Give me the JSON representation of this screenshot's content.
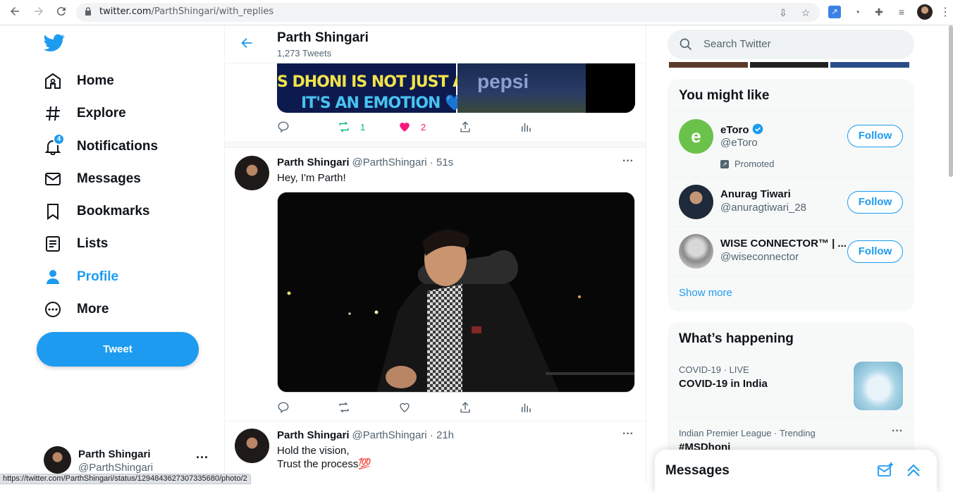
{
  "browser": {
    "url_domain": "twitter.com",
    "url_path": "/ParthShingari/with_replies",
    "status_url": "https://twitter.com/ParthShingari/status/1294843627307335680/photo/2"
  },
  "nav": {
    "items": [
      {
        "label": "Home",
        "icon": "home-icon"
      },
      {
        "label": "Explore",
        "icon": "hashtag-icon"
      },
      {
        "label": "Notifications",
        "icon": "bell-icon",
        "badge": "4"
      },
      {
        "label": "Messages",
        "icon": "envelope-icon"
      },
      {
        "label": "Bookmarks",
        "icon": "bookmark-icon"
      },
      {
        "label": "Lists",
        "icon": "list-icon"
      },
      {
        "label": "Profile",
        "icon": "person-icon",
        "active": true
      },
      {
        "label": "More",
        "icon": "more-circle-icon"
      }
    ],
    "tweet_button": "Tweet",
    "account": {
      "name": "Parth Shingari",
      "handle": "@ParthShingari",
      "more": "···"
    }
  },
  "header": {
    "name": "Parth Shingari",
    "count": "1,273 Tweets"
  },
  "top_media": {
    "text_line1": "S DHONI IS NOT JUST A NA",
    "text_line2": "IT'S AN EMOTION 💙",
    "brand": "pepsi"
  },
  "tweets": [
    {
      "actions": {
        "reply": "",
        "retweet": "1",
        "like": "2",
        "liked": true,
        "retweeted": true
      }
    },
    {
      "name": "Parth Shingari",
      "handle": "@ParthShingari · 51s",
      "text": "Hey, I'm Parth!",
      "more": "···"
    },
    {
      "name": "Parth Shingari",
      "handle": "@ParthShingari · 21h",
      "text1": "Hold the vision,",
      "text2": "Trust the process💯",
      "more": "···"
    }
  ],
  "search": {
    "placeholder": "Search Twitter"
  },
  "might_like": {
    "title": "You might like",
    "suggestions": [
      {
        "name": "eToro",
        "handle": "@eToro",
        "verified": true,
        "promoted": "Promoted",
        "follow": "Follow"
      },
      {
        "name": "Anurag Tiwari",
        "handle": "@anuragtiwari_28",
        "follow": "Follow"
      },
      {
        "name": "WISE CONNECTOR™ | ...",
        "handle": "@wiseconnector",
        "follow": "Follow"
      }
    ],
    "show_more": "Show more"
  },
  "happening": {
    "title": "What’s happening",
    "trends": [
      {
        "meta": "COVID-19 · LIVE",
        "name": "COVID-19 in India"
      },
      {
        "meta": "Indian Premier League · Trending",
        "name": "#MSDhoni",
        "more": "···"
      }
    ]
  },
  "messages_dock": {
    "title": "Messages"
  },
  "colors": {
    "accent": "#1d9bf0",
    "retweet": "#00ba7c",
    "like": "#f91880"
  }
}
